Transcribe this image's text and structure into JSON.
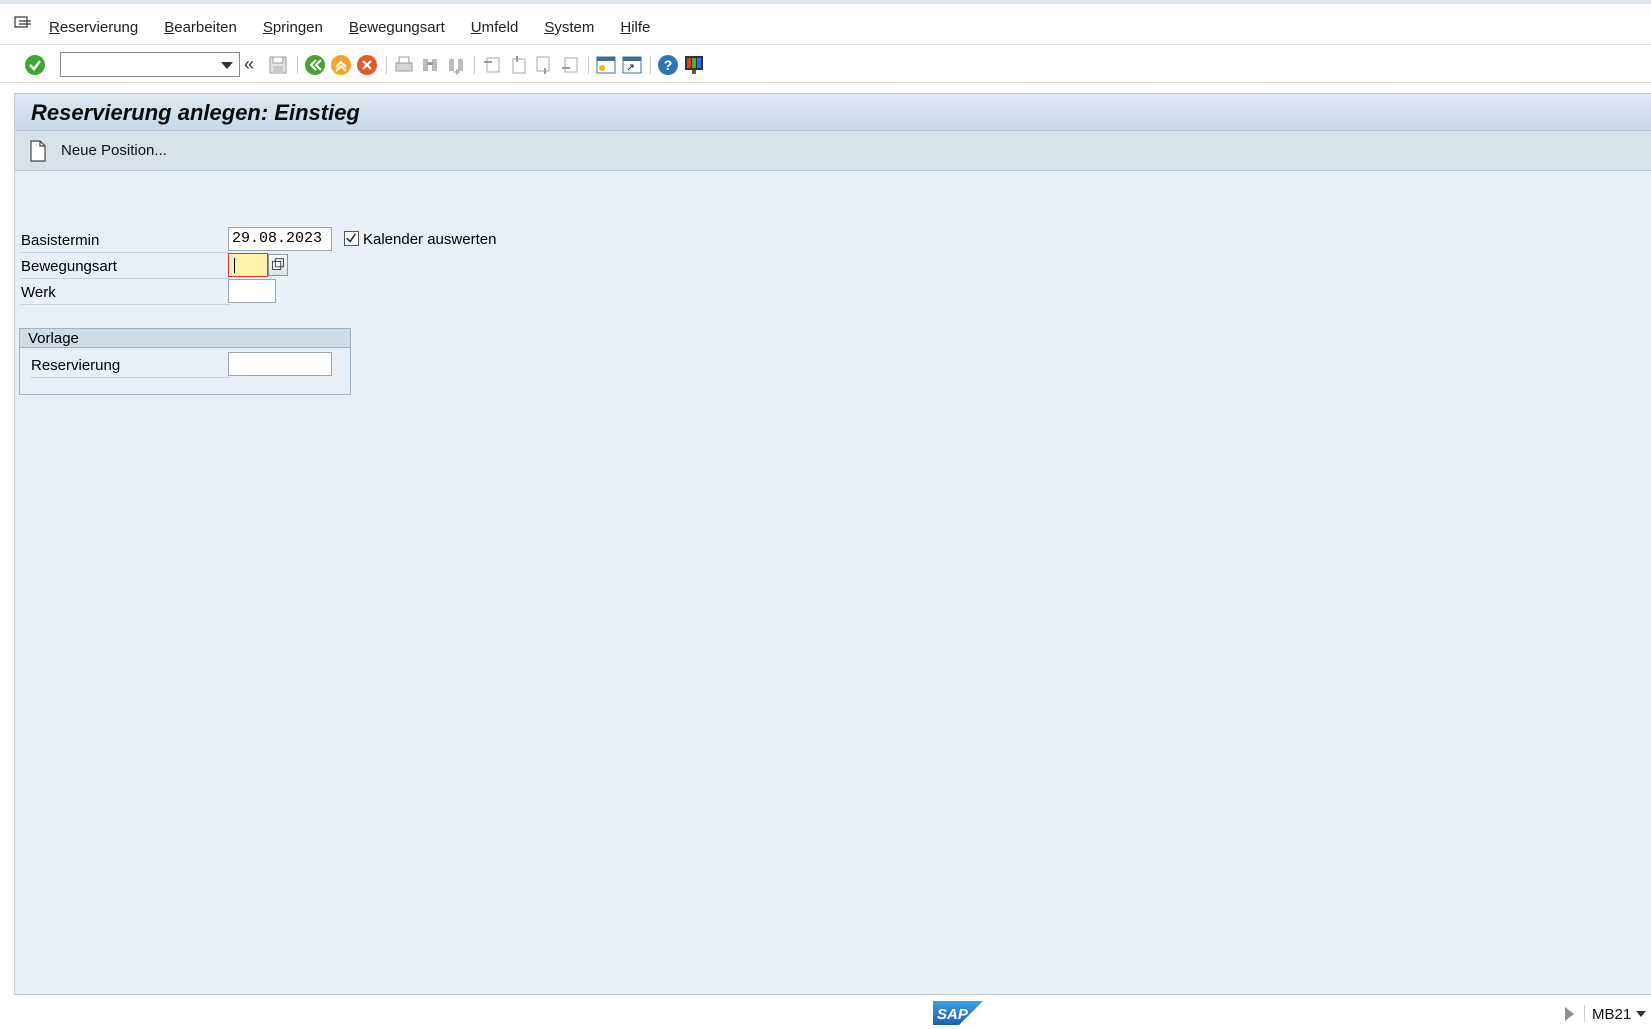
{
  "menu": {
    "items": [
      {
        "label": "Reservierung"
      },
      {
        "label": "Bearbeiten"
      },
      {
        "label": "Springen"
      },
      {
        "label": "Bewegungsart"
      },
      {
        "label": "Umfeld"
      },
      {
        "label": "System"
      },
      {
        "label": "Hilfe"
      }
    ]
  },
  "toolbar": {
    "command_field_value": "",
    "icons": [
      "enter-icon",
      "back-icon",
      "save-icon",
      "back-green-icon",
      "exit-icon",
      "cancel-icon",
      "print-icon",
      "find-icon",
      "find-next-icon",
      "first-page-icon",
      "previous-page-icon",
      "next-page-icon",
      "last-page-icon",
      "new-session-icon",
      "create-shortcut-icon",
      "help-icon",
      "customize-layout-icon"
    ]
  },
  "screen": {
    "title": "Reservierung anlegen: Einstieg",
    "app_toolbar": {
      "new_position_label": "Neue Position..."
    },
    "fields": {
      "basistermin": {
        "label": "Basistermin",
        "value": "29.08.2023"
      },
      "kalender": {
        "label": "Kalender auswerten",
        "checked": true
      },
      "bewegungsart": {
        "label": "Bewegungsart",
        "value": ""
      },
      "werk": {
        "label": "Werk",
        "value": ""
      }
    },
    "vorlage": {
      "title": "Vorlage",
      "reservierung": {
        "label": "Reservierung",
        "value": ""
      }
    }
  },
  "statusbar": {
    "logo": "SAP",
    "tcode": "MB21"
  },
  "colors": {
    "content_bg": "#e8eff6",
    "title_bg": "#c9d9e8",
    "focus_field": "#fdf2a8"
  }
}
